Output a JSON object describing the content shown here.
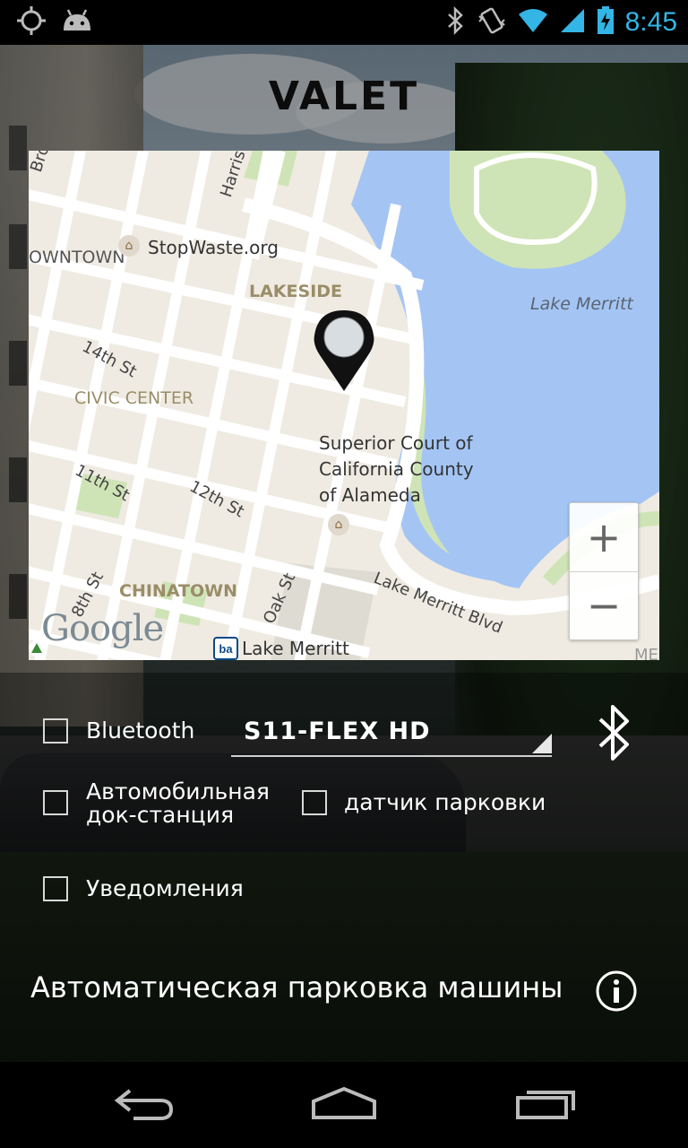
{
  "status_bar": {
    "time": "8:45",
    "icons": [
      "location-target-icon",
      "android-icon",
      "bluetooth-icon",
      "vibrate-icon",
      "wifi-icon",
      "cell-signal-icon",
      "battery-charging-icon"
    ],
    "accent_color": "#33b5e5"
  },
  "header": {
    "title": "VALET"
  },
  "map": {
    "districts": [
      "LAKESIDE",
      "CIVIC CENTER",
      "CHINATOWN",
      "OWNTOWN"
    ],
    "streets": [
      "Broadw",
      "Harris",
      "14th St",
      "11th St",
      "12th St",
      "8th St",
      "Oak St",
      "Lake Merritt Blvd"
    ],
    "pois": [
      "StopWaste.org",
      "Superior Court of",
      "California County",
      "of Alameda",
      "Lake Merritt"
    ],
    "water_label": "Lake Merritt",
    "edge_label": "MERR",
    "zoom_in": "+",
    "zoom_out": "−",
    "provider": "Google",
    "pin_icon": "map-pin-icon"
  },
  "options": {
    "bluetooth_label": "Bluetooth",
    "bluetooth_device": "S11-FLEX HD",
    "dock_label_line1": "Автомобильная",
    "dock_label_line2": "док-станция",
    "parking_sensor_label": "датчик парковки",
    "notifications_label": "Уведомления"
  },
  "footer": {
    "auto_parking_label": "Автоматическая парковка машины",
    "info_icon": "info-icon"
  },
  "nav_bar": {
    "buttons": [
      "back-icon",
      "home-icon",
      "recents-icon"
    ]
  }
}
